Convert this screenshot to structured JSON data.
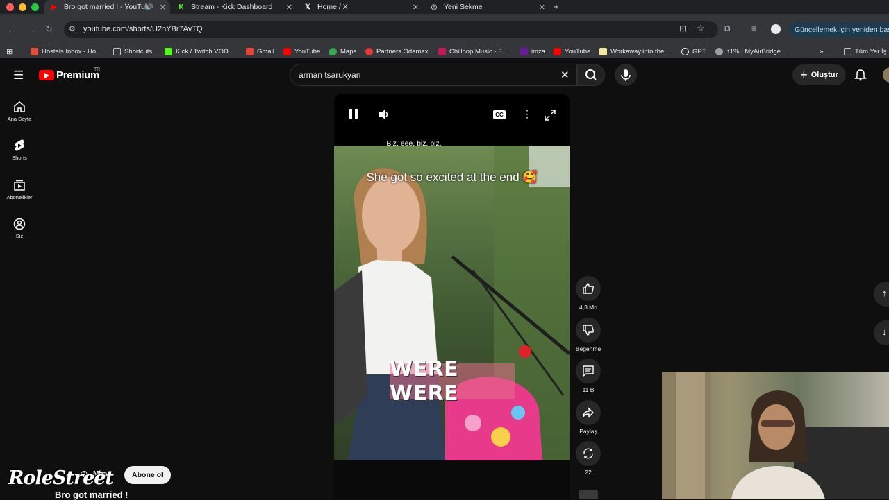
{
  "browser": {
    "tabs": [
      {
        "title": "Bro got married ! - YouTub",
        "active": true
      },
      {
        "title": "Stream - Kick Dashboard",
        "active": false
      },
      {
        "title": "Home / X",
        "active": false
      },
      {
        "title": "Yeni Sekme",
        "active": false
      }
    ],
    "url": "youtube.com/shorts/U2nYBr7AvTQ",
    "update_button": "Güncellemek için yeniden başlat",
    "bookmarks": [
      "Hostels Inbox - Ho...",
      "Shortcuts",
      "Kick / Twitch VOD...",
      "Gmail",
      "YouTube",
      "Maps",
      "Partners Odamax",
      "Chillhop Music - F...",
      "imza",
      "YouTube",
      "Workaway.info the...",
      "GPT",
      "↑1% | MyAirBridge...",
      "Tüm Yer İş"
    ]
  },
  "youtube": {
    "logo": "Premium",
    "logo_region": "TR",
    "search_value": "arman tsarukyan",
    "create_label": "Oluştur",
    "sidebar": [
      {
        "label": "Ana Sayfa",
        "icon": "home-icon"
      },
      {
        "label": "Shorts",
        "icon": "shorts-icon"
      },
      {
        "label": "Abonelikler",
        "icon": "subscriptions-icon"
      },
      {
        "label": "Siz",
        "icon": "you-icon"
      }
    ]
  },
  "short": {
    "caption_line": "Biz, eee, biz, biz,",
    "overlay_title": "She got so excited at the end 🥰",
    "big_caption": "WERE WERE",
    "likes": "4,3 Mn",
    "dislike_label": "Beğenme",
    "comments": "11 B",
    "share_label": "Paylaş",
    "remix_count": "22",
    "channel": "@...Mhan",
    "subscribe_label": "Abone ol",
    "title": "Bro got married !"
  },
  "watermark": "RoleStreet",
  "colors": {
    "youtube_red": "#ff0000",
    "background": "#0f0f0f",
    "chrome": "#35363a"
  }
}
